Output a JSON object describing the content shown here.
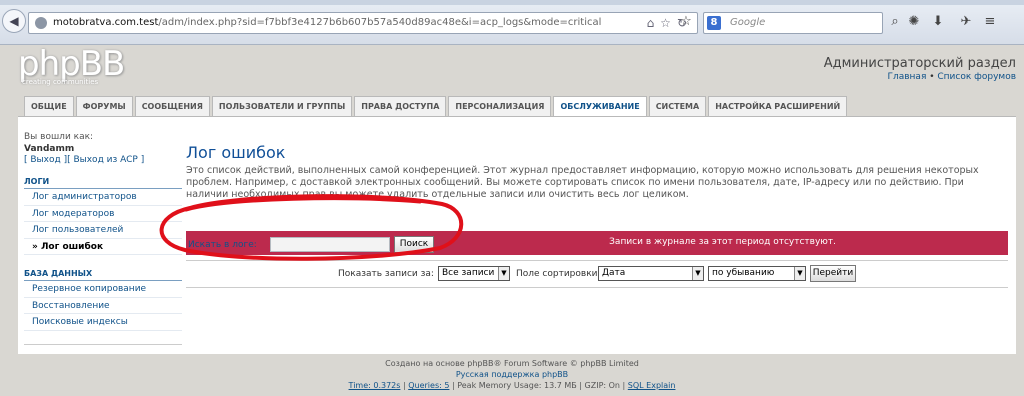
{
  "browser": {
    "url_host": "motobratva.com.test",
    "url_path": "/adm/index.php?sid=f7bbf3e4127b6b607b57a540d89ac48e&i=acp_logs&mode=critical",
    "search_placeholder": "Google",
    "search_engine_badge": "8"
  },
  "header": {
    "logo_text": "phpBB",
    "logo_subtitle": "creating communities",
    "admin_title": "Администраторский раздел",
    "link_home": "Главная",
    "link_sep": " • ",
    "link_forums": "Список форумов"
  },
  "tabs": [
    {
      "label": "ОБЩИЕ"
    },
    {
      "label": "ФОРУМЫ"
    },
    {
      "label": "СООБЩЕНИЯ"
    },
    {
      "label": "ПОЛЬЗОВАТЕЛИ И ГРУППЫ"
    },
    {
      "label": "ПРАВА ДОСТУПА"
    },
    {
      "label": "ПЕРСОНАЛИЗАЦИЯ"
    },
    {
      "label": "ОБСЛУЖИВАНИЕ"
    },
    {
      "label": "СИСТЕМА"
    },
    {
      "label": "НАСТРОЙКА РАСШИРЕНИЙ"
    }
  ],
  "sidebar": {
    "logged_in_as": "Вы вошли как:",
    "username": "Vandamm",
    "logout_links": "[ Выход ][ Выход из ACP ]",
    "section_logs": "ЛОГИ",
    "logs_items": [
      {
        "label": "Лог администраторов"
      },
      {
        "label": "Лог модераторов"
      },
      {
        "label": "Лог пользователей"
      },
      {
        "label": "» Лог ошибок"
      }
    ],
    "section_db": "БАЗА ДАННЫХ",
    "db_items": [
      {
        "label": "Резервное копирование"
      },
      {
        "label": "Восстановление"
      },
      {
        "label": "Поисковые индексы"
      }
    ]
  },
  "main": {
    "title": "Лог ошибок",
    "description": "Это список действий, выполненных самой конференцией. Этот журнал предоставляет информацию, которую можно использовать для решения некоторых проблем. Например, с доставкой электронных сообщений. Вы можете сортировать список по имени пользователя, дате, IP-адресу или по действию. При наличии необходимых прав вы можете удалить отдельные записи или очистить весь лог целиком.",
    "filter_label": "Искать в логе:",
    "filter_value": "",
    "search_button": "Поиск",
    "no_entries": "Записи в журнале за этот период отсутствуют.",
    "show_label": "Показать записи за:",
    "show_value": "Все записи",
    "sort_label": "Поле сортировки:",
    "sort_value": "Дата",
    "order_value": "по убыванию",
    "go_button": "Перейти"
  },
  "footer": {
    "line1": "Создано на основе phpBB® Forum Software © phpBB Limited",
    "line2": "Русская поддержка phpBB",
    "time": "Time: 0.372s",
    "queries": "Queries: 5",
    "memory": "Peak Memory Usage: 13.7 МБ",
    "gzip": "GZIP: On",
    "sql": "SQL Explain"
  },
  "colors": {
    "accent": "#105289",
    "error_bar": "#bc2a4d",
    "annotation": "#e0101a"
  }
}
